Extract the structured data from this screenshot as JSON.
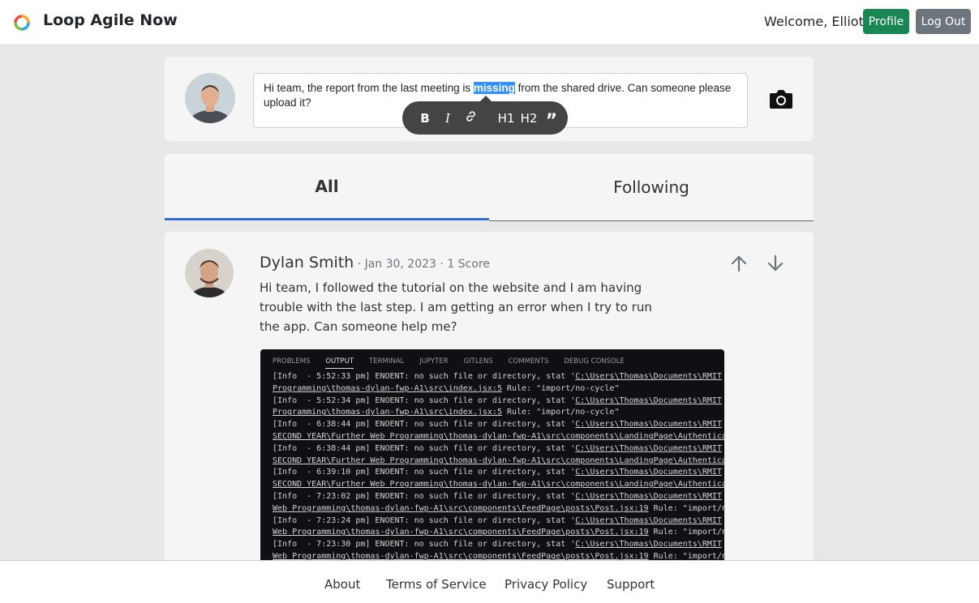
{
  "app": {
    "title": "Loop Agile Now"
  },
  "header": {
    "welcome": "Welcome, Elliott",
    "profile_label": "Profile",
    "logout_label": "Log Out"
  },
  "composer": {
    "text_before": "Hi team, the report from the last meeting is ",
    "text_selected": "missing",
    "text_after": " from the shared drive. Can someone please upload it?",
    "toolbar": [
      "B",
      "I",
      "link-icon",
      "H1",
      "H2",
      "quote-icon"
    ],
    "camera_icon": "camera-icon"
  },
  "tabs": [
    {
      "label": "All",
      "active": true
    },
    {
      "label": "Following",
      "active": false
    }
  ],
  "post": {
    "author": "Dylan Smith",
    "date": "Jan 30, 2023",
    "score": "1 Score",
    "body": "Hi team, I followed the tutorial on the website and I am having trouble with the last step. I am getting an error when I try to run the app. Can someone help me?",
    "upvote_icon": "arrow-up-icon",
    "downvote_icon": "arrow-down-icon",
    "attachment": {
      "tabs": [
        "PROBLEMS",
        "OUTPUT",
        "TERMINAL",
        "JUPYTER",
        "GITLENS",
        "COMMENTS",
        "DEBUG CONSOLE"
      ],
      "active_tab": "OUTPUT",
      "lines": [
        {
          "pre": "[Info  - 5:52:33 pm] ENOENT: no such file or directory, stat '",
          "link": "C:\\Users\\Thomas\\Documents\\RMIT",
          "post": ""
        },
        {
          "pre": "",
          "link": "Programming\\thomas-dylan-fwp-A1\\src\\index.jsx:5",
          "post": " Rule: \"import/no-cycle\""
        },
        {
          "pre": "[Info  - 5:52:34 pm] ENOENT: no such file or directory, stat '",
          "link": "C:\\Users\\Thomas\\Documents\\RMIT",
          "post": ""
        },
        {
          "pre": "",
          "link": "Programming\\thomas-dylan-fwp-A1\\src\\index.jsx:5",
          "post": " Rule: \"import/no-cycle\""
        },
        {
          "pre": "[Info  - 6:38:44 pm] ENOENT: no such file or directory, stat '",
          "link": "C:\\Users\\Thomas\\Documents\\RMIT",
          "post": ""
        },
        {
          "pre": "",
          "link": "SECOND YEAR\\Further Web Programming\\thomas-dylan-fwp-A1\\src\\components\\LandingPage\\Authentica",
          "post": ""
        },
        {
          "pre": "[Info  - 6:38:44 pm] ENOENT: no such file or directory, stat '",
          "link": "C:\\Users\\Thomas\\Documents\\RMIT",
          "post": ""
        },
        {
          "pre": "",
          "link": "SECOND YEAR\\Further Web Programming\\thomas-dylan-fwp-A1\\src\\components\\LandingPage\\Authentica",
          "post": ""
        },
        {
          "pre": "[Info  - 6:39:10 pm] ENOENT: no such file or directory, stat '",
          "link": "C:\\Users\\Thomas\\Documents\\RMIT",
          "post": ""
        },
        {
          "pre": "",
          "link": "SECOND YEAR\\Further Web Programming\\thomas-dylan-fwp-A1\\src\\components\\LandingPage\\Authentica",
          "post": ""
        },
        {
          "pre": "[Info  - 7:23:02 pm] ENOENT: no such file or directory, stat '",
          "link": "C:\\Users\\Thomas\\Documents\\RMIT",
          "post": ""
        },
        {
          "pre": "",
          "link": "Web Programming\\thomas-dylan-fwp-A1\\src\\components\\FeedPage\\posts\\Post.jsx:19",
          "post": " Rule: \"import/n"
        },
        {
          "pre": "[Info  - 7:23:24 pm] ENOENT: no such file or directory, stat '",
          "link": "C:\\Users\\Thomas\\Documents\\RMIT",
          "post": ""
        },
        {
          "pre": "",
          "link": "Web Programming\\thomas-dylan-fwp-A1\\src\\components\\FeedPage\\posts\\Post.jsx:19",
          "post": " Rule: \"import/n"
        },
        {
          "pre": "[Info  - 7:23:30 pm] ENOENT: no such file or directory, stat '",
          "link": "C:\\Users\\Thomas\\Documents\\RMIT",
          "post": ""
        },
        {
          "pre": "",
          "link": "Web Programming\\thomas-dylan-fwp-A1\\src\\components\\FeedPage\\posts\\Post.jsx:19",
          "post": " Rule: \"import/n"
        }
      ]
    }
  },
  "footer": {
    "links": [
      "About",
      "Terms of Service",
      "Privacy Policy",
      "Support"
    ]
  },
  "colors": {
    "profile_button": "#198754",
    "logout_button": "#6c757d",
    "active_tab_underline": "#2f6ad9",
    "selection": "#3390ff"
  }
}
